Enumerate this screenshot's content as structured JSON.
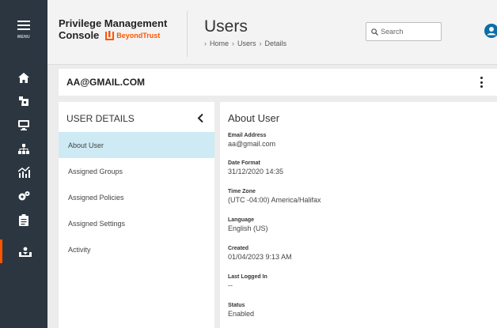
{
  "rail": {
    "menu_label": "MENU",
    "items": [
      {
        "icon": "home-icon"
      },
      {
        "icon": "device-tag-icon"
      },
      {
        "icon": "computer-icon"
      },
      {
        "icon": "hierarchy-icon"
      },
      {
        "icon": "analytics-icon"
      },
      {
        "icon": "settings-gears-icon"
      },
      {
        "icon": "clipboard-icon"
      },
      {
        "icon": "user-download-icon",
        "active": true
      }
    ]
  },
  "header": {
    "brand_line1": "Privilege Management",
    "brand_line2": "Console",
    "logo_text": "BeyondTrust",
    "title": "Users",
    "breadcrumb": [
      "Home",
      "Users",
      "Details"
    ],
    "search_placeholder": "Search"
  },
  "user": {
    "email_heading": "AA@GMAIL.COM"
  },
  "left_panel": {
    "title": "USER DETAILS",
    "items": [
      "About User",
      "Assigned Groups",
      "Assigned Policies",
      "Assigned Settings",
      "Activity"
    ],
    "selected": "About User"
  },
  "about": {
    "title": "About User",
    "fields": [
      {
        "label": "Email Address",
        "value": "aa@gmail.com"
      },
      {
        "label": "Date Format",
        "value": "31/12/2020 14:35"
      },
      {
        "label": "Time Zone",
        "value": "(UTC -04:00) America/Halifax"
      },
      {
        "label": "Language",
        "value": "English (US)"
      },
      {
        "label": "Created",
        "value": "01/04/2023 9:13 AM"
      },
      {
        "label": "Last Logged In",
        "value": "--"
      },
      {
        "label": "Status",
        "value": "Enabled"
      }
    ]
  },
  "colors": {
    "rail": "#2b3640",
    "accent": "#ff5500",
    "selected_bg": "#cdeaf5",
    "avatar": "#0a6ea8"
  }
}
